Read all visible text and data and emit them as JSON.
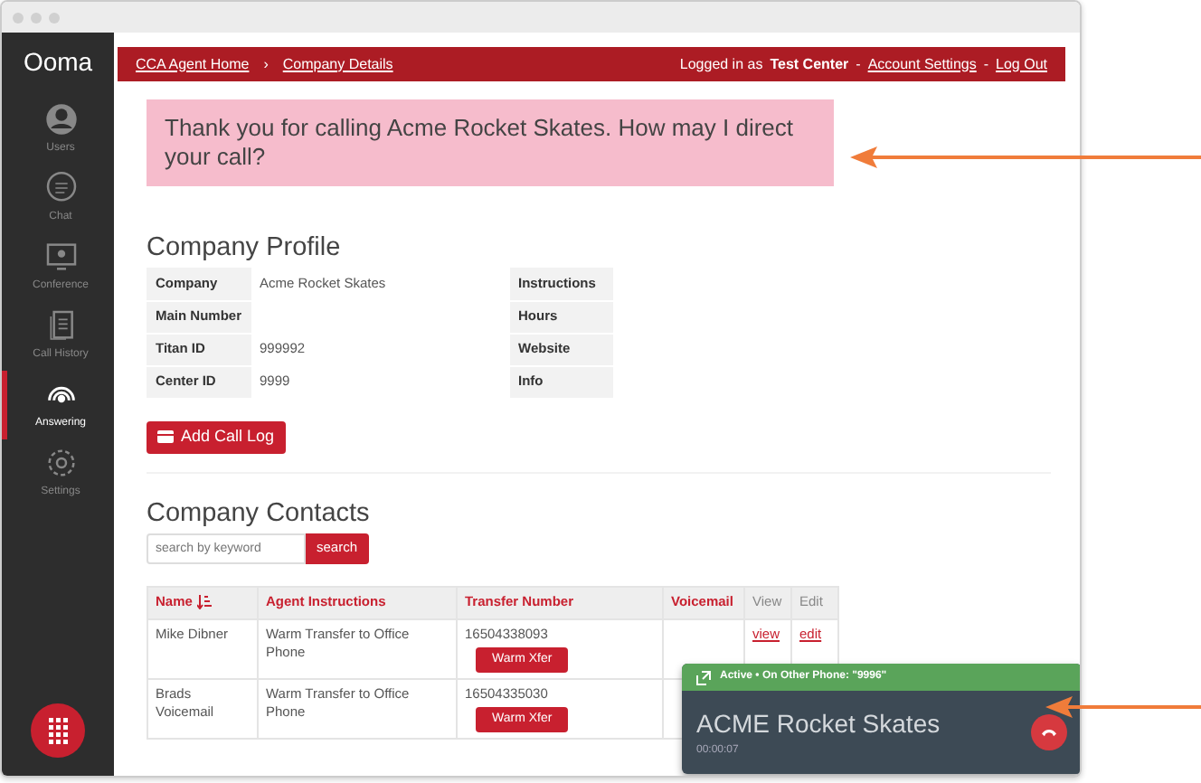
{
  "sidebar": {
    "logo": "Ooma",
    "items": [
      {
        "label": "Users",
        "kind": "user",
        "selected": false
      },
      {
        "label": "Chat",
        "kind": "chat",
        "selected": false
      },
      {
        "label": "Conference",
        "kind": "conference",
        "selected": false
      },
      {
        "label": "Call History",
        "kind": "history",
        "selected": false
      },
      {
        "label": "Answering",
        "kind": "answering",
        "selected": true
      },
      {
        "label": "Settings",
        "kind": "settings",
        "selected": false
      }
    ]
  },
  "header": {
    "breadcrumbs": [
      "CCA Agent Home",
      "Company Details"
    ],
    "separator": "›",
    "prefix": "Logged in as",
    "user": "Test Center",
    "links": [
      "Account Settings",
      "Log Out"
    ],
    "link_separator": "-"
  },
  "greeting": "Thank you for calling Acme Rocket Skates. How may I direct your call?",
  "profile": {
    "title": "Company Profile",
    "fields": [
      {
        "label": "Company",
        "value": "Acme Rocket Skates"
      },
      {
        "label": "Main Number"
      },
      {
        "label": "Titan ID",
        "value": "999992"
      },
      {
        "label": "Center ID",
        "value": "9999"
      }
    ],
    "side_labels": [
      "Instructions",
      "Hours",
      "Website",
      "Info"
    ],
    "button": "Add Call Log"
  },
  "contacts": {
    "title": "Company Contacts",
    "search": {
      "placeholder": "search by keyword",
      "button": "search"
    },
    "columns": [
      {
        "label": "Name",
        "highlighted": true,
        "sorted": true
      },
      {
        "label": "Agent Instructions",
        "highlighted": true,
        "sorted": false
      },
      {
        "label": "Transfer Number",
        "highlighted": true,
        "sorted": false
      },
      {
        "label": "Voicemail",
        "highlighted": true,
        "sorted": false
      },
      {
        "label": "View",
        "highlighted": false,
        "sorted": false
      },
      {
        "label": "Edit",
        "highlighted": false,
        "sorted": false
      }
    ],
    "rows": [
      {
        "name": "Mike Dibner",
        "instructions": "Warm Transfer to Office Phone",
        "number": "16504338093",
        "button": "Warm Xfer",
        "view": "view",
        "edit": "edit"
      },
      {
        "name": "Brads Voicemail",
        "instructions": "Warm Transfer to Office Phone",
        "number": "16504335030",
        "button": "Warm Xfer"
      }
    ]
  },
  "call": {
    "status": "Active • On Other Phone: \"9996\"",
    "name": "ACME Rocket Skates",
    "timer": "00:00:07"
  }
}
